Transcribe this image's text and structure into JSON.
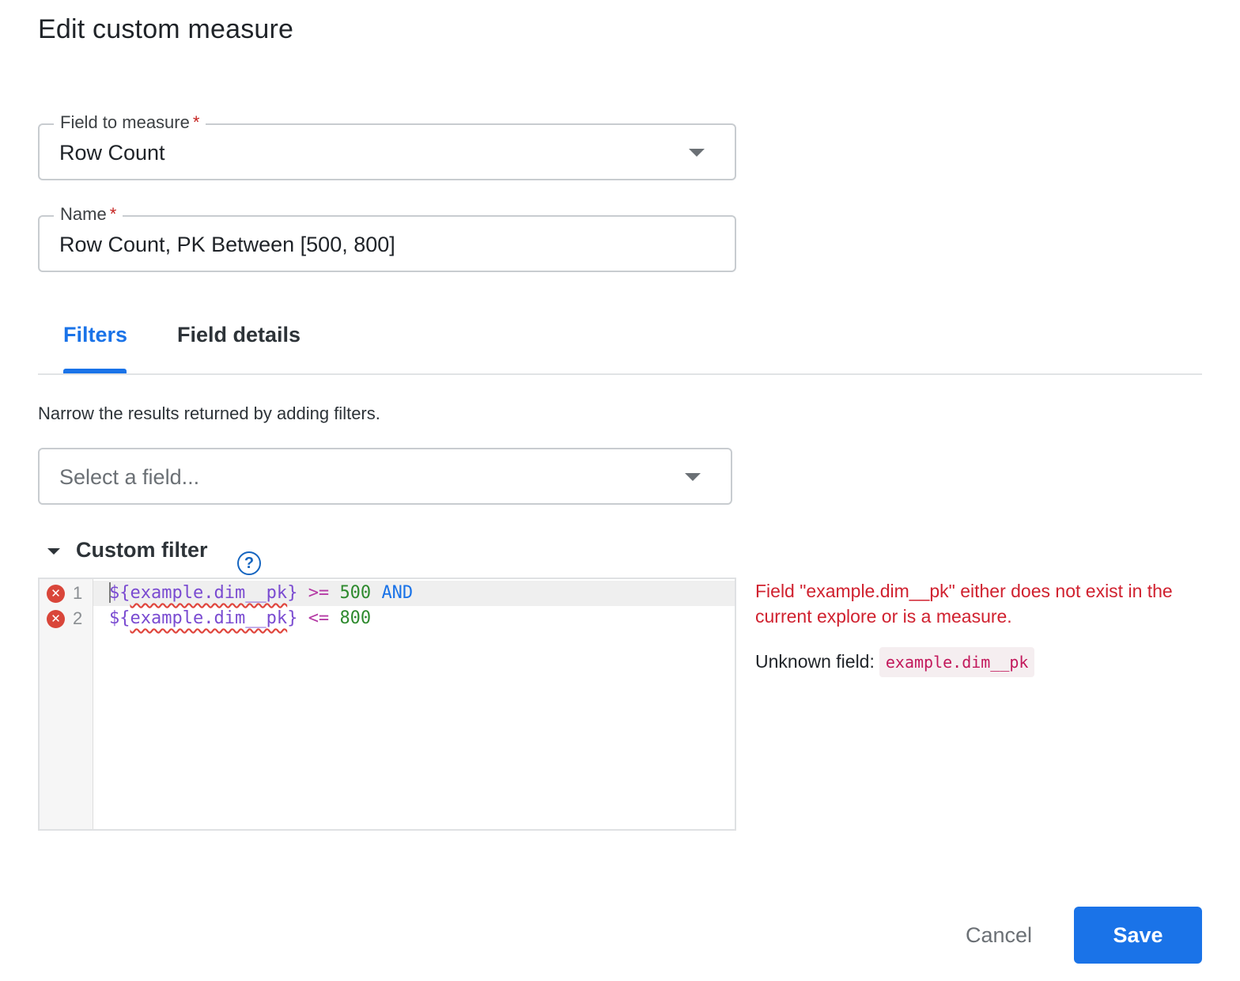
{
  "dialog": {
    "title": "Edit custom measure"
  },
  "field_to_measure": {
    "label": "Field to measure",
    "required_mark": "*",
    "value": "Row Count"
  },
  "name": {
    "label": "Name",
    "required_mark": "*",
    "value": "Row Count, PK Between [500, 800]"
  },
  "tabs": [
    {
      "label": "Filters",
      "active": true
    },
    {
      "label": "Field details",
      "active": false
    }
  ],
  "filters": {
    "helper_text": "Narrow the results returned by adding filters.",
    "select_field_placeholder": "Select a field..."
  },
  "custom_filter": {
    "heading": "Custom filter",
    "help_icon": "?",
    "lines": [
      {
        "number": "1",
        "var_open": "${",
        "field": "example.dim__pk",
        "var_close": "}",
        "op": ">=",
        "num": "500",
        "keyword": "AND"
      },
      {
        "number": "2",
        "var_open": "${",
        "field": "example.dim__pk",
        "var_close": "}",
        "op": "<=",
        "num": "800",
        "keyword": ""
      }
    ],
    "error_marker": "✕"
  },
  "error": {
    "message": "Field \"example.dim__pk\" either does not exist in the current explore or is a measure.",
    "unknown_label": "Unknown field:",
    "unknown_value": "example.dim__pk"
  },
  "actions": {
    "cancel_label": "Cancel",
    "save_label": "Save"
  },
  "colors": {
    "accent": "#1a73e8",
    "error": "#d0212f",
    "required": "#c5221f"
  },
  "icons": [
    "chevron-down-icon",
    "collapse-triangle-icon",
    "help-circle-icon",
    "error-circle-icon"
  ]
}
